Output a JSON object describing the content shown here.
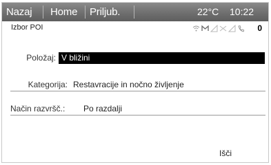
{
  "topbar": {
    "back_label": "Nazaj",
    "home_label": "Home",
    "attach_label": "Priljub.",
    "temperature": "22°C",
    "time": "10:22"
  },
  "subheader": {
    "title": "Izbor POI",
    "icons": [
      "wifi-icon",
      "message-icon",
      "signal-icon",
      "mute-signal-icon",
      "signal-strength-icon",
      "phone-icon"
    ],
    "count": "0"
  },
  "form": {
    "location": {
      "label": "Položaj:",
      "value": "V bližini"
    },
    "category": {
      "label": "Kategorija:",
      "value": "Restavracije in nočno življenje"
    },
    "sort": {
      "label": "Način razvršč.:",
      "value": "Po razdalji"
    }
  },
  "actions": {
    "search_label": "Išči"
  },
  "colors": {
    "topbar": "#6f6f6f",
    "selected_bg": "#000000",
    "selected_text": "#ffffff"
  }
}
